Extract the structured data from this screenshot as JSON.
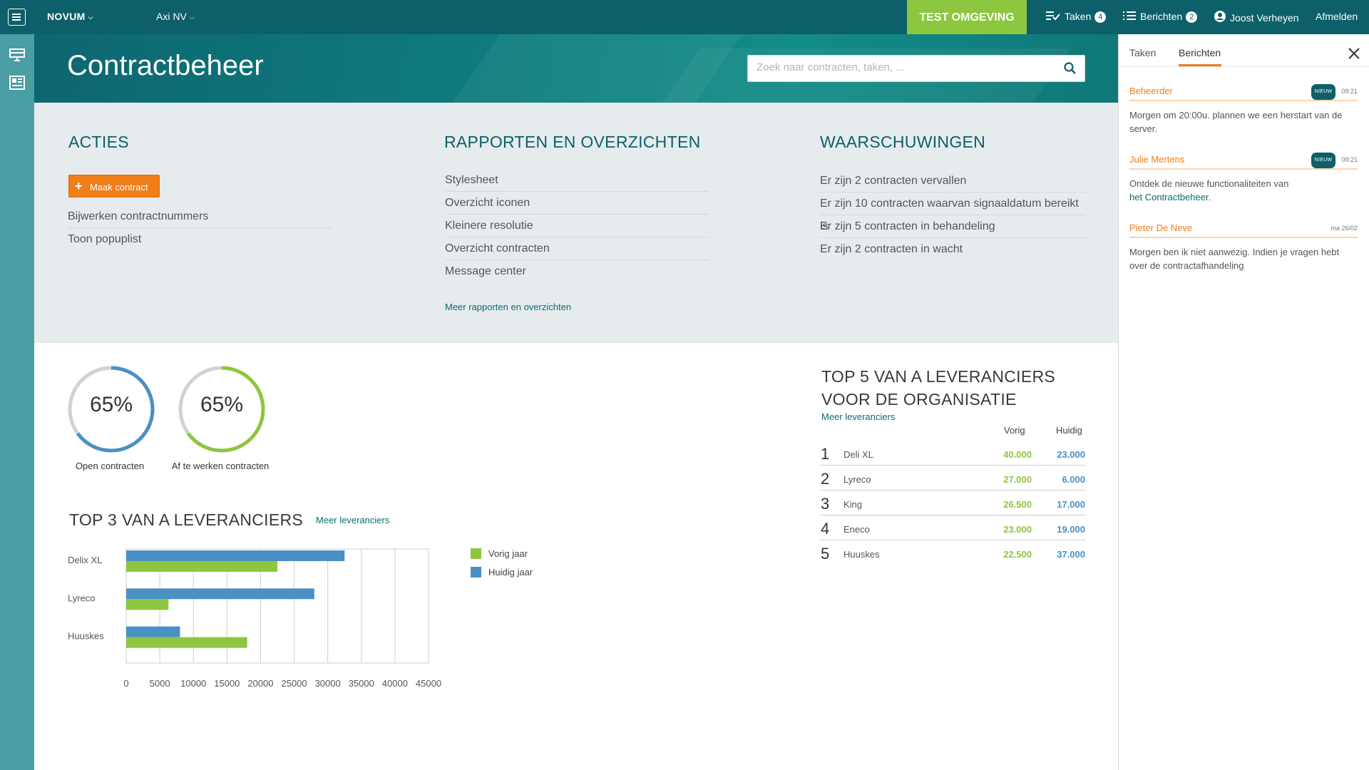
{
  "topbar": {
    "brand": "NOVUM",
    "organisation": "Axi NV",
    "environment": "TEST OMGEVING",
    "tasks_label": "Taken",
    "tasks_count": "4",
    "messages_label": "Berichten",
    "messages_count": "2",
    "user_name": "Joost Verheyen",
    "logout_label": "Afmelden"
  },
  "header": {
    "title": "Contractbeheer",
    "search_placeholder": "Zoek naar contracten, taken, ..."
  },
  "actions": {
    "title": "ACTIES",
    "create_button": "Maak contract",
    "items": [
      "Bijwerken contractnummers",
      "Toon popuplist"
    ]
  },
  "reports": {
    "title": "RAPPORTEN EN OVERZICHTEN",
    "items": [
      "Stylesheet",
      "Overzicht iconen",
      "Kleinere resolutie",
      "Overzicht contracten",
      "Message center"
    ],
    "more_link": "Meer rapporten en overzichten"
  },
  "warnings": {
    "title": "WAARSCHUWINGEN",
    "items": [
      "Er zijn 2 contracten vervallen",
      "Er zijn 10 contracten waarvan signaaldatum bereikt is",
      "Er zijn 5 contracten in behandeling",
      "Er zijn 2 contracten in wacht"
    ]
  },
  "gauges": [
    {
      "value_label": "65%",
      "value": 0.65,
      "label": "Open contracten",
      "color": "#4a90c5"
    },
    {
      "value_label": "65%",
      "value": 0.65,
      "label": "Af te werken contracten",
      "color": "#8dc63f"
    }
  ],
  "top3": {
    "title": "TOP 3 VAN A LEVERANCIERS",
    "more_link": "Meer leveranciers"
  },
  "chart_data": {
    "type": "bar",
    "orientation": "horizontal",
    "categories": [
      "Delix XL",
      "Lyreco",
      "Huuskes"
    ],
    "series": [
      {
        "name": "Vorig jaar",
        "color": "#8dc63f",
        "values": [
          22500,
          6300,
          18000
        ]
      },
      {
        "name": "Huidig jaar",
        "color": "#4a90c5",
        "values": [
          32500,
          28000,
          8000
        ]
      }
    ],
    "xlim": [
      0,
      45000
    ],
    "xticks": [
      0,
      5000,
      10000,
      15000,
      20000,
      25000,
      30000,
      35000,
      40000,
      45000
    ],
    "grid": true,
    "legend": "right"
  },
  "top5": {
    "title_line1": "TOP 5 VAN A LEVERANCIERS",
    "title_line2": "VOOR DE ORGANISATIE",
    "more_link": "Meer leveranciers",
    "col_prev": "Vorig",
    "col_cur": "Huidig",
    "rows": [
      {
        "rank": "1",
        "name": "Deli XL",
        "prev": "40.000",
        "cur": "23.000"
      },
      {
        "rank": "2",
        "name": "Lyreco",
        "prev": "27.000",
        "cur": "6.000"
      },
      {
        "rank": "3",
        "name": "King",
        "prev": "26.500",
        "cur": "17.000"
      },
      {
        "rank": "4",
        "name": "Eneco",
        "prev": "23.000",
        "cur": "19.000"
      },
      {
        "rank": "5",
        "name": "Huuskes",
        "prev": "22.500",
        "cur": "37.000"
      }
    ]
  },
  "panel": {
    "tab_tasks": "Taken",
    "tab_messages": "Berichten",
    "new_badge": "NIEUW",
    "messages": [
      {
        "from": "Beheerder",
        "time": "09:21",
        "body": "Morgen om 20:00u. plannen we een herstart van de server."
      },
      {
        "from": "Julie Mertens",
        "time": "09:21",
        "body": "Ontdek de nieuwe functionaliteiten van",
        "link": "het Contractbeheer",
        "tail": "."
      },
      {
        "from": "Pieter De Neve",
        "time": "ma 26/02",
        "body": "Morgen ben ik niet aanwezig. Indien je vragen hebt over de contractafhandeling"
      }
    ]
  }
}
